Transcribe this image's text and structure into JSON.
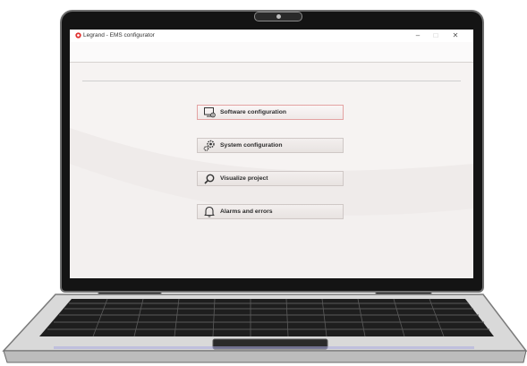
{
  "window": {
    "title": "Legrand - EMS configurator",
    "controls": {
      "minimize": "–",
      "maximize": "□",
      "close": "✕"
    }
  },
  "menu": {
    "items": [
      {
        "label": "Software configuration",
        "icon": "monitor-gear-icon",
        "active": true
      },
      {
        "label": "System configuration",
        "icon": "gears-icon",
        "active": false
      },
      {
        "label": "Visualize project",
        "icon": "magnifier-icon",
        "active": false
      },
      {
        "label": "Alarms and errors",
        "icon": "bell-icon",
        "active": false
      }
    ]
  },
  "colors": {
    "accent": "#e3a3a3",
    "screen_background": "#f6f3f2",
    "bezel": "#141414",
    "brand_icon": "#e0312f"
  }
}
